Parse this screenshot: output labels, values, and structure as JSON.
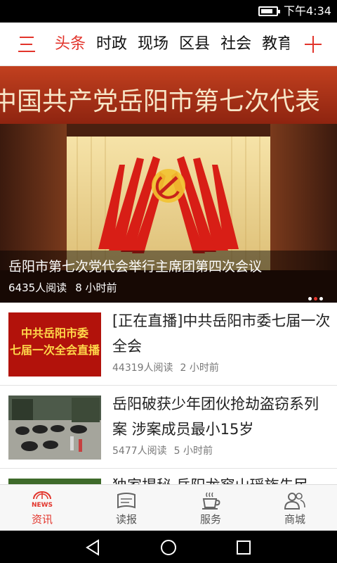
{
  "status_bar": {
    "time": "下午4:34",
    "battery_level": 0.8
  },
  "top_nav": {
    "tabs": [
      {
        "label": "头条",
        "active": true
      },
      {
        "label": "时政",
        "active": false
      },
      {
        "label": "现场",
        "active": false
      },
      {
        "label": "区县",
        "active": false
      },
      {
        "label": "社会",
        "active": false
      },
      {
        "label": "教育",
        "active": false
      }
    ]
  },
  "hero": {
    "banner_text": "中国共产党岳阳市第七次代表",
    "title": "岳阳市第七次党代会举行主席团第四次会议",
    "reads": "6435人阅读",
    "time": "8 小时前",
    "carousel_count": 3,
    "carousel_active": 1
  },
  "news": [
    {
      "title": "[正在直播]中共岳阳市委七届一次全会",
      "reads": "44319人阅读",
      "time": "2 小时前",
      "thumb_lines": [
        "中共岳阳市委",
        "七届一次全会直播"
      ]
    },
    {
      "title": "岳阳破获少年团伙抢劫盗窃系列案 涉案成员最小15岁",
      "reads": "5477人阅读",
      "time": "5 小时前"
    },
    {
      "title": "独家揭秘  岳阳龙窖山瑶族先民"
    }
  ],
  "bottom_tabs": [
    {
      "label": "资讯",
      "icon": "news-icon",
      "active": true,
      "badge": "NEWS"
    },
    {
      "label": "读报",
      "icon": "newspaper-icon",
      "active": false
    },
    {
      "label": "服务",
      "icon": "coffee-cup-icon",
      "active": false
    },
    {
      "label": "商城",
      "icon": "users-icon",
      "active": false
    }
  ],
  "colors": {
    "accent": "#e2342b",
    "text": "#222222",
    "meta": "#777777"
  }
}
